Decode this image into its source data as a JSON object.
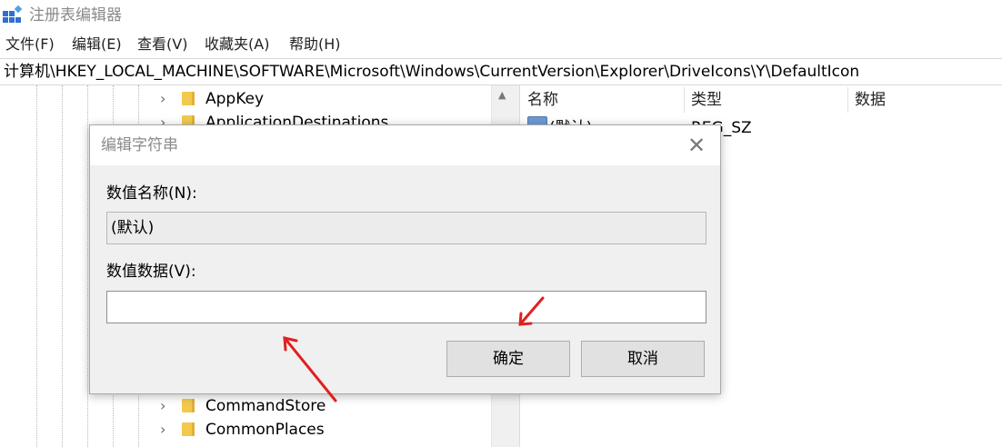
{
  "window": {
    "title": "注册表编辑器"
  },
  "menu": {
    "file": "文件(F)",
    "edit": "编辑(E)",
    "view": "查看(V)",
    "favorites": "收藏夹(A)",
    "help": "帮助(H)"
  },
  "address": "计算机\\HKEY_LOCAL_MACHINE\\SOFTWARE\\Microsoft\\Windows\\CurrentVersion\\Explorer\\DriveIcons\\Y\\DefaultIcon",
  "tree": {
    "items": [
      "AppKey",
      "ApplicationDestinations",
      "CommandStore",
      "CommonPlaces"
    ]
  },
  "list": {
    "columns": [
      "名称",
      "类型",
      "数据"
    ],
    "rows": [
      {
        "name": "(默认)",
        "type": "REG_SZ",
        "data": ""
      }
    ]
  },
  "dialog": {
    "title": "编辑字符串",
    "name_label": "数值名称(N):",
    "name_value": "(默认)",
    "data_label": "数值数据(V):",
    "data_value": "",
    "ok": "确定",
    "cancel": "取消"
  },
  "colors": {
    "annotation_arrow": "#e02020",
    "folder": "#f2c94c",
    "dialog_bg": "#f0f0f0"
  },
  "icons": [
    "regedit-app-icon",
    "chevron-right-icon",
    "folder-icon",
    "reg-string-icon",
    "close-icon",
    "scroll-up-icon"
  ]
}
